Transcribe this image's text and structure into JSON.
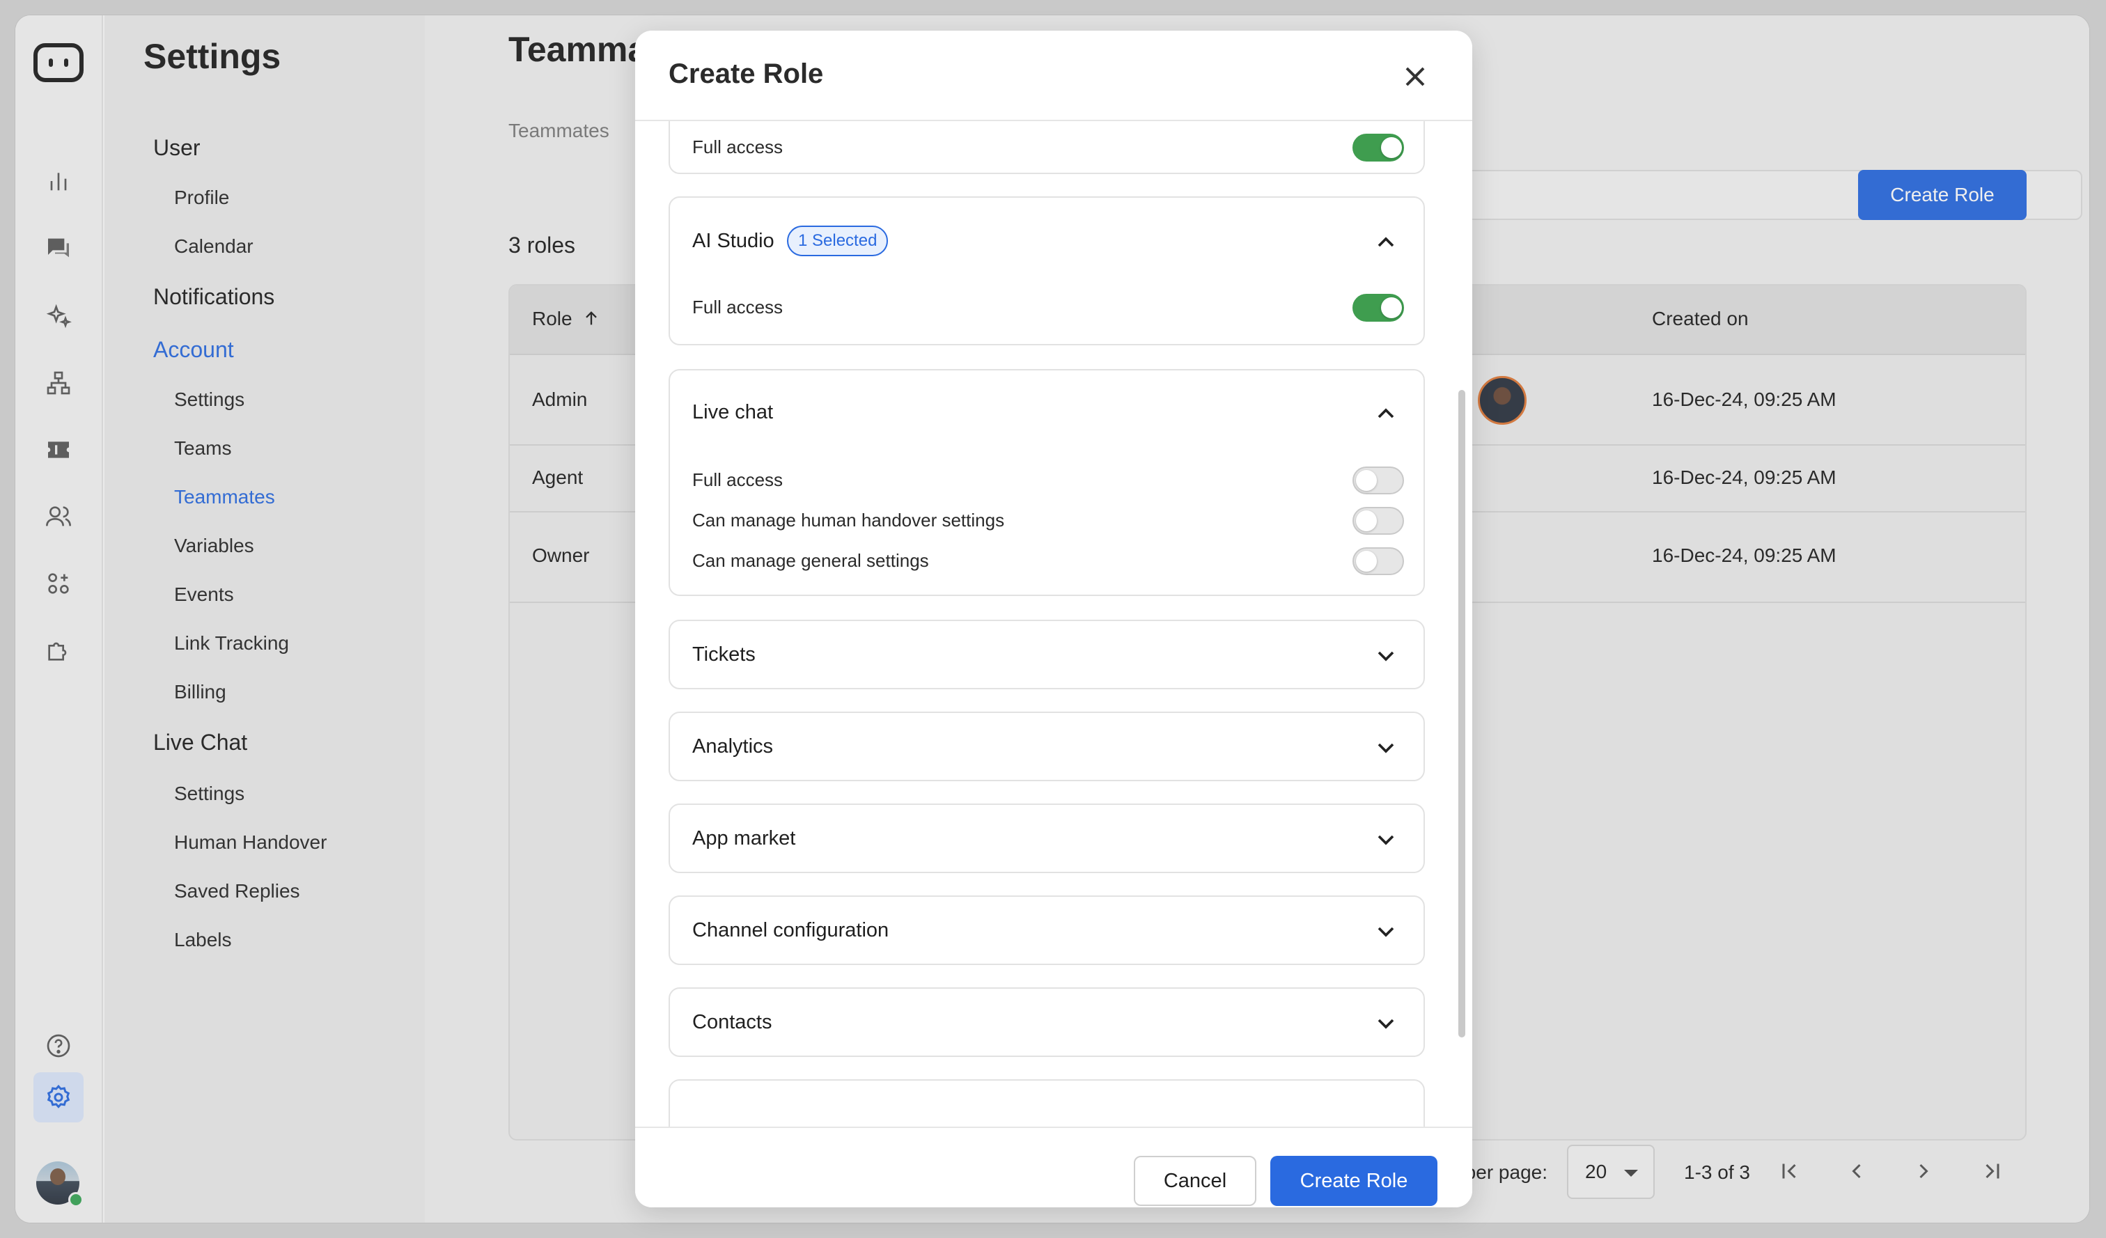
{
  "sidebar": {
    "title": "Settings",
    "sections": [
      {
        "label": "User",
        "items": [
          "Profile",
          "Calendar"
        ]
      },
      {
        "label": "Notifications",
        "items": []
      },
      {
        "label": "Account",
        "items": [
          "Settings",
          "Teams",
          "Teammates",
          "Variables",
          "Events",
          "Link Tracking",
          "Billing"
        ]
      },
      {
        "label": "Live Chat",
        "items": [
          "Settings",
          "Human Handover",
          "Saved Replies",
          "Labels"
        ]
      }
    ],
    "active_section": "Account",
    "active_item": "Teammates"
  },
  "rail": {
    "icons": [
      "analytics-icon",
      "chat-icon",
      "sparkle-icon",
      "flow-icon",
      "ticket-icon",
      "users-icon",
      "apps-icon",
      "plugin-icon",
      "help-icon",
      "gear-icon"
    ],
    "active": "gear-icon",
    "avatar_status": "online"
  },
  "main": {
    "title": "Teammates",
    "tab": "Teammates",
    "roles_count": "3 roles",
    "create_button": "Create Role",
    "table": {
      "columns": [
        "Role",
        "Created on"
      ],
      "rows": [
        {
          "role": "Admin",
          "created_on": "16-Dec-24, 09:25 AM"
        },
        {
          "role": "Agent",
          "created_on": "16-Dec-24, 09:25 AM"
        },
        {
          "role": "Owner",
          "created_on": "16-Dec-24, 09:25 AM"
        }
      ]
    },
    "pagination": {
      "per_page_label": "Rows per page:",
      "per_page": "20",
      "range": "1-3 of 3"
    }
  },
  "modal": {
    "title": "Create Role",
    "top_card": {
      "perm": "Full access",
      "on": true
    },
    "ai_studio": {
      "title": "AI Studio",
      "badge": "1 Selected",
      "perms": [
        {
          "label": "Full access",
          "on": true
        }
      ]
    },
    "live_chat": {
      "title": "Live chat",
      "perms": [
        {
          "label": "Full access",
          "on": false
        },
        {
          "label": "Can manage human handover settings",
          "on": false
        },
        {
          "label": "Can manage general settings",
          "on": false
        }
      ]
    },
    "collapsed": [
      "Tickets",
      "Analytics",
      "App market",
      "Channel configuration",
      "Contacts"
    ],
    "cancel": "Cancel",
    "create": "Create Role"
  }
}
